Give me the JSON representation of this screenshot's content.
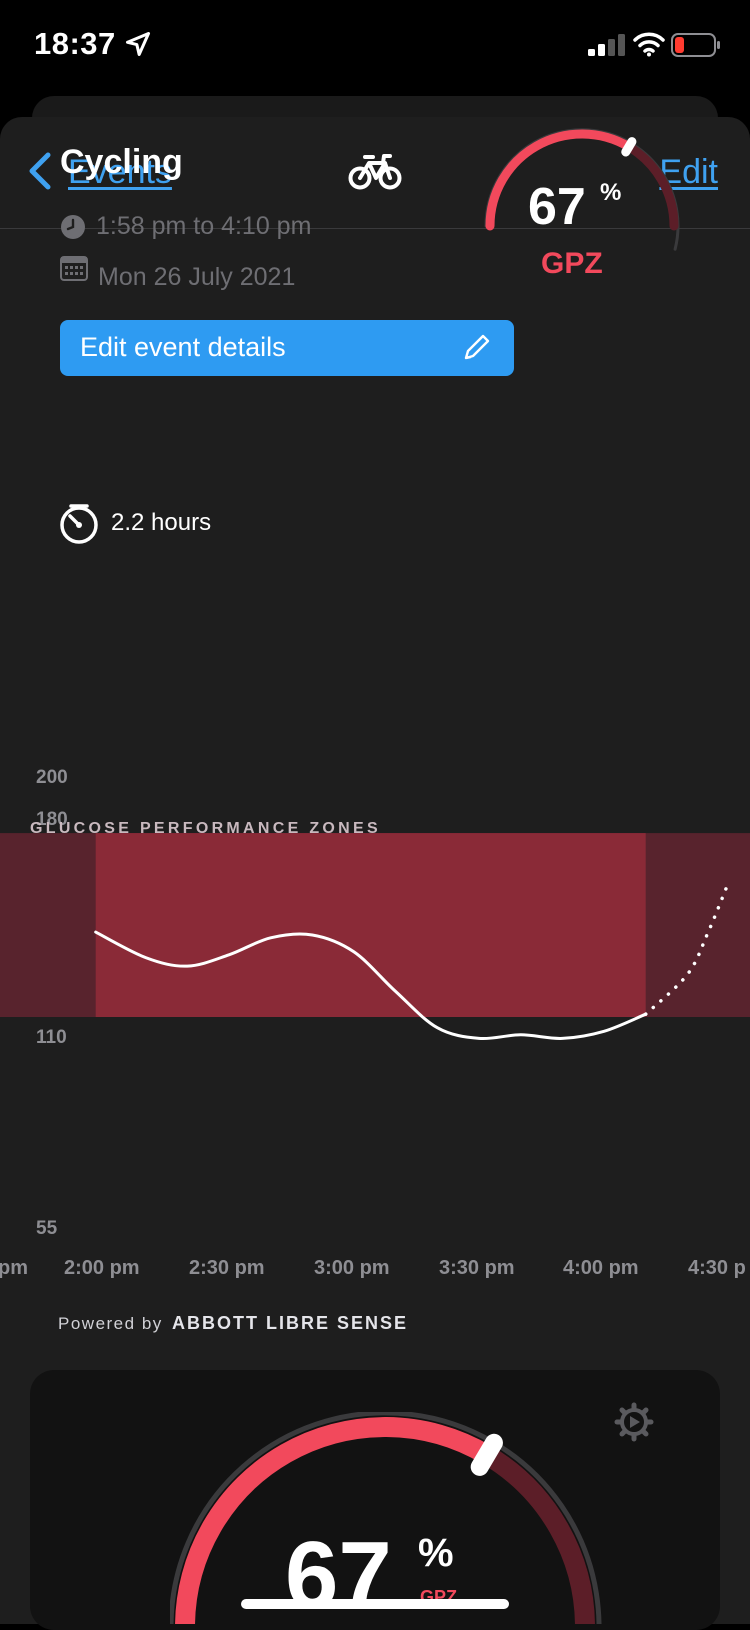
{
  "status_bar": {
    "time": "18:37"
  },
  "nav": {
    "back_label": "Events",
    "edit_label": "Edit",
    "activity_icon": "bicycle-icon"
  },
  "event": {
    "title": "Cycling",
    "time_range": "1:58 pm to 4:10 pm",
    "date": "Mon 26 July 2021",
    "edit_button_label": "Edit event details",
    "duration": "2.2 hours"
  },
  "gpz_small": {
    "value": "67",
    "unit": "%",
    "label": "GPZ",
    "percent": 67
  },
  "chart_data": {
    "type": "line",
    "title": "GLUCOSE PERFORMANCE ZONES",
    "y_ticks": [
      "200",
      "180",
      "110",
      "55"
    ],
    "x_ticks": [
      "pm",
      "2:00 pm",
      "2:30 pm",
      "3:00 pm",
      "3:30 pm",
      "4:00 pm",
      "4:30 p"
    ],
    "zone": {
      "low": 110,
      "high": 175
    },
    "series": [
      {
        "style": "solid",
        "x": [
          "1:58 pm",
          "2:10 pm",
          "2:20 pm",
          "2:30 pm",
          "2:40 pm",
          "2:50 pm",
          "3:00 pm",
          "3:10 pm",
          "3:20 pm",
          "3:30 pm",
          "3:40 pm",
          "3:50 pm",
          "4:00 pm",
          "4:10 pm"
        ],
        "values": [
          140,
          131,
          128,
          132,
          138,
          139,
          133,
          119,
          107,
          104,
          105,
          104,
          106,
          111
        ]
      },
      {
        "style": "dotted",
        "x": [
          "4:10 pm",
          "4:20 pm",
          "4:25 pm",
          "4:30 pm"
        ],
        "values": [
          111,
          125,
          140,
          158
        ]
      }
    ]
  },
  "footer": {
    "powered_by": "Powered by",
    "brand": "ABBOTT LIBRE SENSE"
  },
  "gpz_big": {
    "value": "67",
    "unit": "%",
    "label": "GPZ",
    "percent": 67
  },
  "colors": {
    "accent_blue": "#3fa1f0",
    "button_blue": "#2e9bf2",
    "gpz_red": "#f2495c",
    "zone_red": "#8a2a37"
  }
}
